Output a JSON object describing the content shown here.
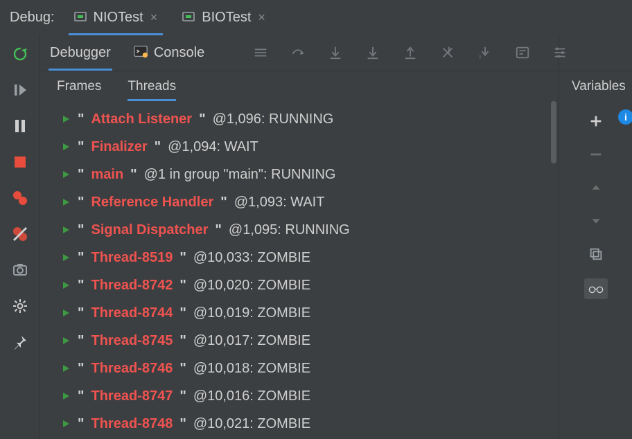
{
  "top": {
    "label": "Debug:",
    "tabs": [
      {
        "label": "NIOTest",
        "active": true
      },
      {
        "label": "BIOTest",
        "active": false
      }
    ]
  },
  "tool_tabs": {
    "debugger": "Debugger",
    "console": "Console"
  },
  "inner_tabs": {
    "frames": "Frames",
    "threads": "Threads"
  },
  "variables_label": "Variables",
  "threads": [
    {
      "name": "Attach Listener",
      "suffix": "@1,096: RUNNING"
    },
    {
      "name": "Finalizer",
      "suffix": "@1,094: WAIT"
    },
    {
      "name": "main",
      "suffix": "@1 in group \"main\": RUNNING"
    },
    {
      "name": "Reference Handler",
      "suffix": "@1,093: WAIT"
    },
    {
      "name": "Signal Dispatcher",
      "suffix": "@1,095: RUNNING"
    },
    {
      "name": "Thread-8519",
      "suffix": "@10,033: ZOMBIE"
    },
    {
      "name": "Thread-8742",
      "suffix": "@10,020: ZOMBIE"
    },
    {
      "name": "Thread-8744",
      "suffix": "@10,019: ZOMBIE"
    },
    {
      "name": "Thread-8745",
      "suffix": "@10,017: ZOMBIE"
    },
    {
      "name": "Thread-8746",
      "suffix": "@10,018: ZOMBIE"
    },
    {
      "name": "Thread-8747",
      "suffix": "@10,016: ZOMBIE"
    },
    {
      "name": "Thread-8748",
      "suffix": "@10,021: ZOMBIE"
    }
  ]
}
